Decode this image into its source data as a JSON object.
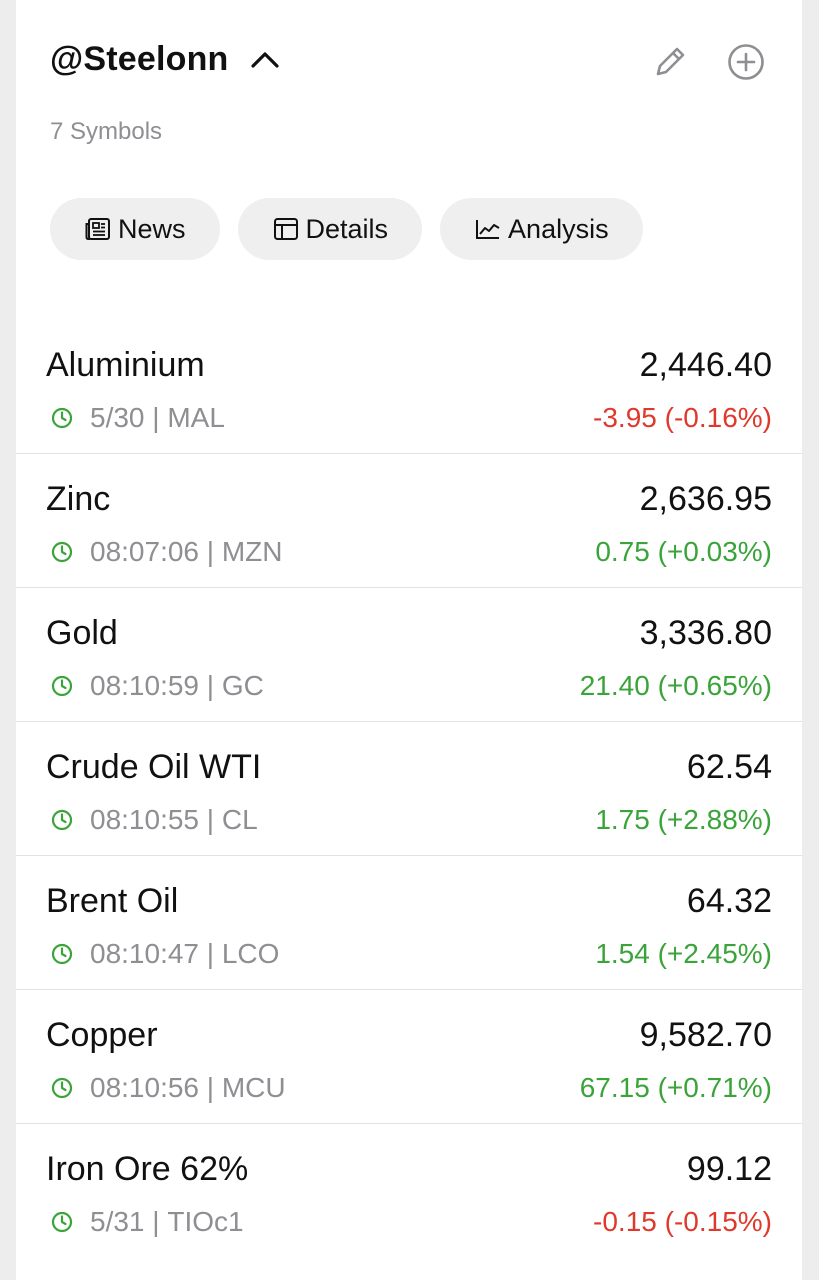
{
  "header": {
    "title": "@Steelonn",
    "subtitle": "7 Symbols"
  },
  "chips": [
    {
      "label": "News",
      "icon": "newspaper-icon"
    },
    {
      "label": "Details",
      "icon": "table-icon"
    },
    {
      "label": "Analysis",
      "icon": "line-chart-icon"
    }
  ],
  "colors": {
    "positive": "#3aa43a",
    "negative": "#e0392b",
    "muted": "#8e8e93"
  },
  "symbols": [
    {
      "name": "Aluminium",
      "price": "2,446.40",
      "time": "5/30",
      "code": "MAL",
      "change": "-3.95",
      "pct": "(-0.16%)",
      "dir": "neg"
    },
    {
      "name": "Zinc",
      "price": "2,636.95",
      "time": "08:07:06",
      "code": "MZN",
      "change": "0.75",
      "pct": "(+0.03%)",
      "dir": "pos"
    },
    {
      "name": "Gold",
      "price": "3,336.80",
      "time": "08:10:59",
      "code": "GC",
      "change": "21.40",
      "pct": "(+0.65%)",
      "dir": "pos"
    },
    {
      "name": "Crude Oil WTI",
      "price": "62.54",
      "time": "08:10:55",
      "code": "CL",
      "change": "1.75",
      "pct": "(+2.88%)",
      "dir": "pos"
    },
    {
      "name": "Brent Oil",
      "price": "64.32",
      "time": "08:10:47",
      "code": "LCO",
      "change": "1.54",
      "pct": "(+2.45%)",
      "dir": "pos"
    },
    {
      "name": "Copper",
      "price": "9,582.70",
      "time": "08:10:56",
      "code": "MCU",
      "change": "67.15",
      "pct": "(+0.71%)",
      "dir": "pos"
    },
    {
      "name": "Iron Ore 62%",
      "price": "99.12",
      "time": "5/31",
      "code": "TIOc1",
      "change": "-0.15",
      "pct": "(-0.15%)",
      "dir": "neg"
    }
  ]
}
